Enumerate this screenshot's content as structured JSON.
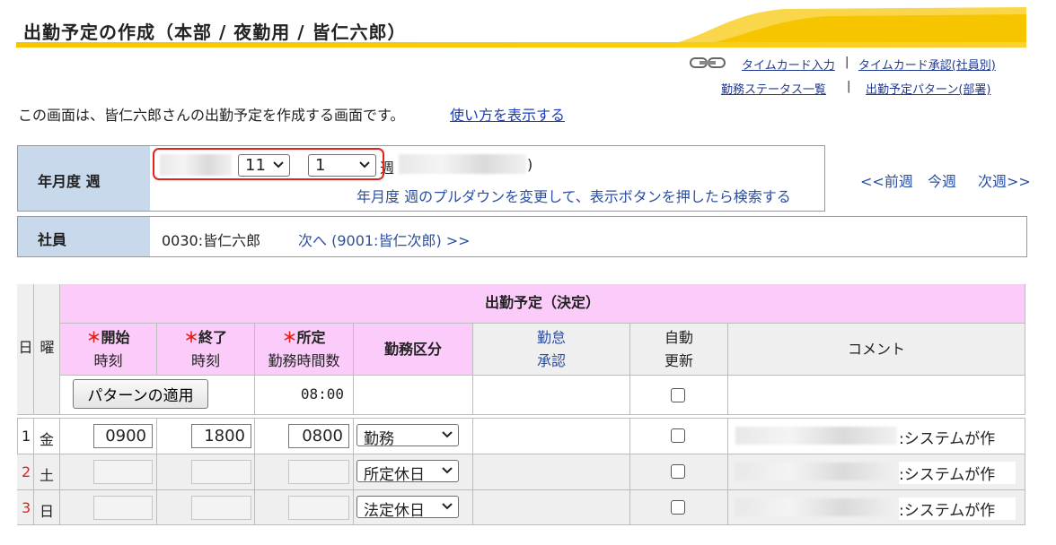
{
  "header": {
    "title": "出勤予定の作成（本部 / 夜勤用 / 皆仁六郎）",
    "accent": "#f7c400"
  },
  "links": {
    "timecard_input": "タイムカード入力",
    "timecard_approve": "タイムカード承認(社員別)",
    "work_status": "勤務ステータス一覧",
    "pattern": "出勤予定パターン(部署)",
    "separator": "|"
  },
  "description": {
    "text": "この画面は、皆仁六郎さんの出勤予定を作成する画面です。",
    "howto": "使い方を表示する"
  },
  "filter": {
    "label": "年月度 週",
    "month_value": "11",
    "week_value": "1",
    "week_suffix": "週",
    "paren_close": ")",
    "hint": "年月度 週のプルダウンを変更して、表示ボタンを押したら検索する",
    "prev_week": "<<前週",
    "this_week": "今週",
    "next_week": "次週>>"
  },
  "employee": {
    "label": "社員",
    "value": "0030:皆仁六郎",
    "next": "次へ (9001:皆仁次郎) >>"
  },
  "table": {
    "group_header": "出勤予定（決定）",
    "headers": {
      "day": "日",
      "weekday": "曜",
      "start_star": "＊",
      "start_l1": "開始",
      "start_l2": "時刻",
      "end_star": "＊",
      "end_l1": "終了",
      "end_l2": "時刻",
      "std_star": "＊",
      "std_l1": "所定",
      "std_l2": "勤務時間数",
      "work_type": "勤務区分",
      "approval_l1": "勤怠",
      "approval_l2": "承認",
      "auto_l1": "自動",
      "auto_l2": "更新",
      "comment": "コメント"
    },
    "apply_pattern_button": "パターンの適用",
    "default_hours": "08:00",
    "rows": [
      {
        "day": "1",
        "weekday": "金",
        "start": "0900",
        "end": "1800",
        "hours": "0800",
        "work_type": "勤務",
        "comment": ":システムが作",
        "day_color": "#222222"
      },
      {
        "day": "2",
        "weekday": "土",
        "start": "",
        "end": "",
        "hours": "",
        "work_type": "所定休日",
        "comment": ":システムが作",
        "day_color": "#e2231a"
      },
      {
        "day": "3",
        "weekday": "日",
        "start": "",
        "end": "",
        "hours": "",
        "work_type": "法定休日",
        "comment": ":システムが作",
        "day_color": "#e2231a"
      }
    ]
  }
}
